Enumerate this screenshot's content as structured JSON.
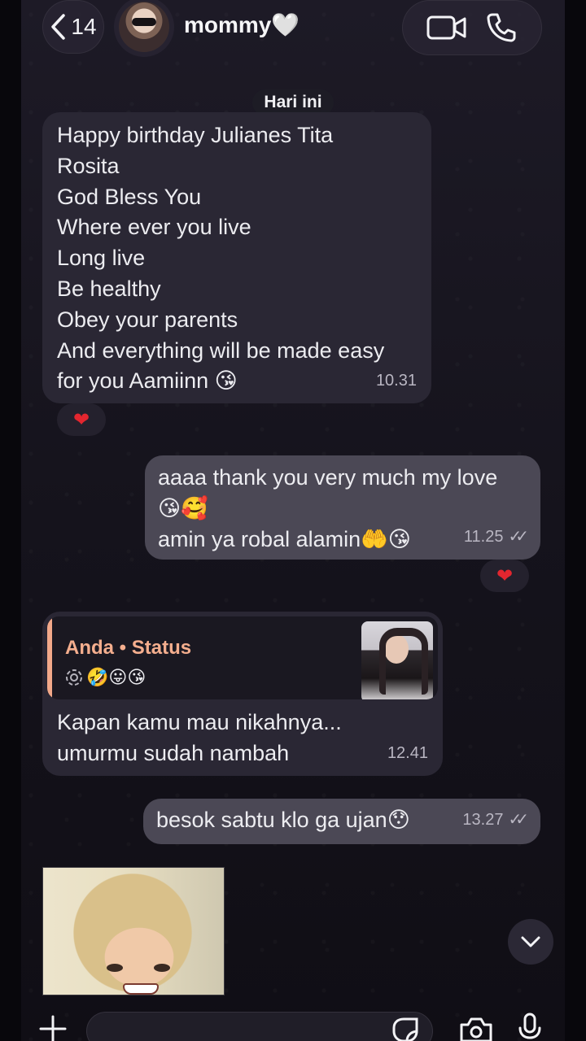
{
  "header": {
    "back_count": "14",
    "contact_name": "mommy🤍"
  },
  "date_separator": "Hari ini",
  "messages": [
    {
      "direction": "in",
      "lines": [
        "Happy birthday Julianes Tita",
        "Rosita",
        "God Bless You",
        "Where ever you live",
        "Long live",
        "Be healthy",
        "Obey your parents",
        "And everything will be made easy",
        "for you Aamiinn  😘"
      ],
      "time": "10.31",
      "reaction": "❤"
    },
    {
      "direction": "out",
      "lines": [
        "aaaa thank you very much my love",
        "😘🥰",
        "amin ya robal alamin🤲😘"
      ],
      "time": "11.25",
      "read_mark": "✓✓",
      "reaction": "❤"
    },
    {
      "direction": "in",
      "quote_title": "Anda • Status",
      "quote_text": "🤣😛😘",
      "lines": [
        "Kapan kamu mau nikahnya...",
        "umurmu sudah nambah"
      ],
      "time": "12.41"
    },
    {
      "direction": "out",
      "lines": [
        "besok sabtu klo ga ujan😯"
      ],
      "time": "13.27",
      "read_mark": "✓✓"
    }
  ],
  "icons": {
    "back": "chevron-left-icon",
    "video": "video-camera-icon",
    "call": "phone-icon",
    "add": "plus-icon",
    "sticker": "sticker-icon",
    "camera": "camera-icon",
    "mic": "microphone-icon",
    "scroll": "chevron-down-icon"
  },
  "colors": {
    "incoming_bubble": "#2a2734",
    "outgoing_bubble": "#4b4855",
    "quote_accent": "#f4ae8e",
    "reaction_heart": "#e3262f"
  }
}
